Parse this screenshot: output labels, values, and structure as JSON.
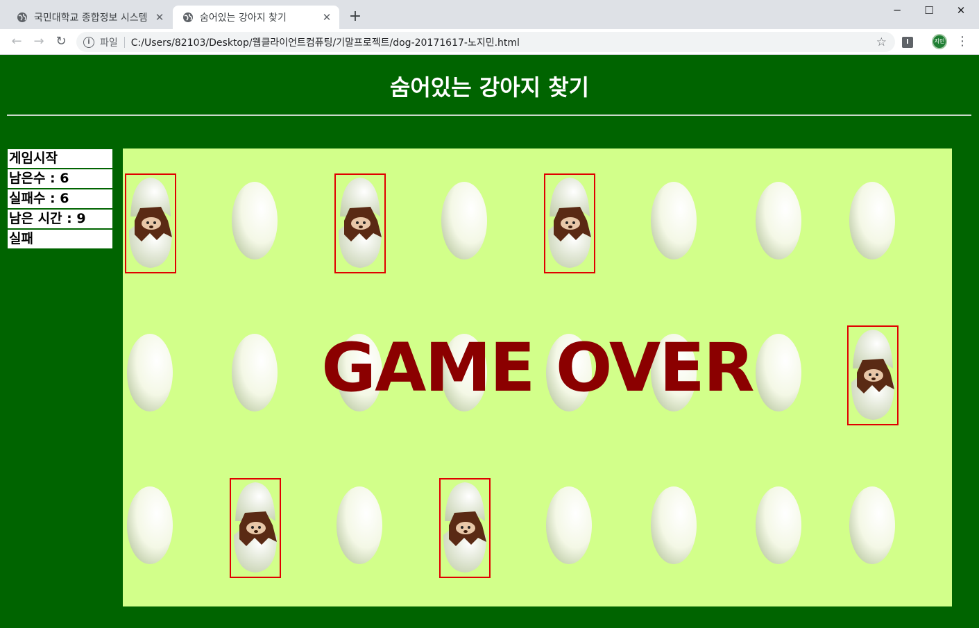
{
  "browser": {
    "tabs": [
      {
        "title": "국민대학교 종합정보 시스템",
        "active": false,
        "icon": "globe-icon"
      },
      {
        "title": "숨어있는 강아지 찾기",
        "active": true,
        "icon": "globe-icon"
      }
    ],
    "new_tab_label": "+",
    "window_controls": {
      "minimize": "─",
      "maximize": "☐",
      "close": "✕"
    },
    "nav": {
      "back": "←",
      "forward": "→",
      "reload": "↻"
    },
    "address": {
      "info_icon": "i",
      "scheme_label": "파일",
      "url": "C:/Users/82103/Desktop/웹클라이언트컴퓨팅/기말프로젝트/dog-20171617-노지민.html"
    },
    "profile_label": "지민",
    "ext_label": "I"
  },
  "page": {
    "title": "숨어있는 강아지 찾기",
    "status": {
      "start_button": "게임시작",
      "remaining": "남은수 : 6",
      "failures": "실패수 : 6",
      "time_left": "남은 시간 : 9",
      "result": "실패"
    },
    "overlay_text": "GAME OVER",
    "board": {
      "rows": [
        [
          "dog",
          "egg",
          "dog",
          "egg",
          "dog",
          "egg",
          "egg",
          "egg"
        ],
        [
          "egg",
          "egg",
          "egg",
          "egg",
          "egg",
          "egg",
          "egg",
          "dog"
        ],
        [
          "egg",
          "dog",
          "egg",
          "dog",
          "egg",
          "egg",
          "egg",
          "egg"
        ]
      ]
    },
    "colors": {
      "background": "#006400",
      "board": "#d2ff8a",
      "highlight": "#e00000",
      "game_over": "#8b0000"
    }
  }
}
